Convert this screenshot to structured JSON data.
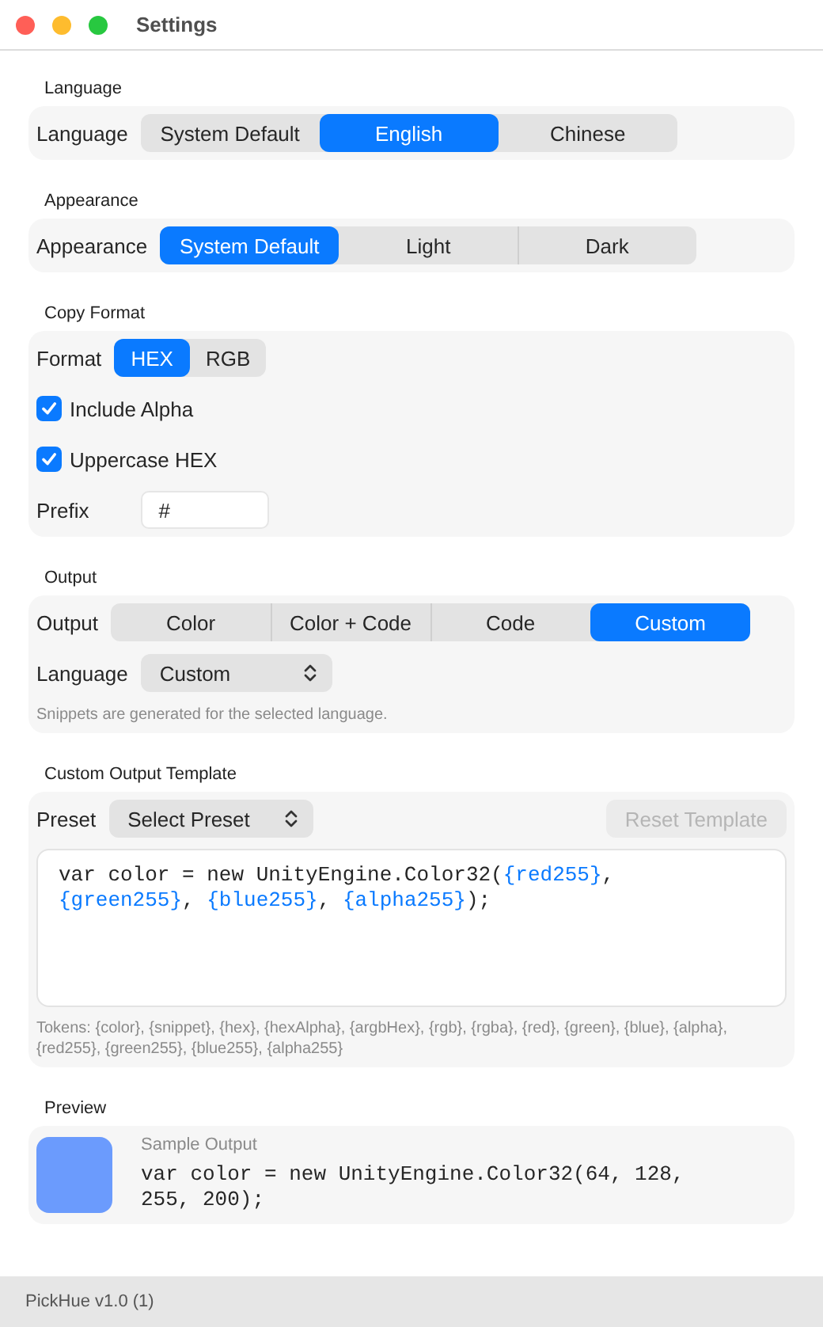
{
  "window": {
    "title": "Settings"
  },
  "language": {
    "heading": "Language",
    "label": "Language",
    "options": [
      {
        "label": "System Default",
        "selected": false
      },
      {
        "label": "English",
        "selected": true
      },
      {
        "label": "Chinese",
        "selected": false
      }
    ]
  },
  "appearance": {
    "heading": "Appearance",
    "label": "Appearance",
    "options": [
      {
        "label": "System Default",
        "selected": true
      },
      {
        "label": "Light",
        "selected": false
      },
      {
        "label": "Dark",
        "selected": false
      }
    ]
  },
  "copy_format": {
    "heading": "Copy Format",
    "format": {
      "label": "Format",
      "options": [
        {
          "label": "HEX",
          "selected": true
        },
        {
          "label": "RGB",
          "selected": false
        }
      ]
    },
    "checkboxes": [
      {
        "label": "Include Alpha",
        "checked": true
      },
      {
        "label": "Uppercase HEX",
        "checked": true
      }
    ],
    "prefix": {
      "label": "Prefix",
      "value": "#"
    }
  },
  "output": {
    "heading": "Output",
    "label": "Output",
    "options": [
      {
        "label": "Color",
        "selected": false
      },
      {
        "label": "Color + Code",
        "selected": false
      },
      {
        "label": "Code",
        "selected": false
      },
      {
        "label": "Custom",
        "selected": true
      }
    ],
    "language": {
      "label": "Language",
      "value": "Custom"
    },
    "note": "Snippets are generated for the selected language."
  },
  "custom_output_template": {
    "heading": "Custom Output Template",
    "preset": {
      "label": "Preset",
      "value": "Select Preset"
    },
    "reset_button": {
      "label": "Reset Template",
      "disabled": true
    },
    "template": [
      {
        "kind": "text",
        "text": "var color = new UnityEngine.Color32("
      },
      {
        "kind": "token",
        "text": "{red255}"
      },
      {
        "kind": "text",
        "text": ", "
      },
      {
        "kind": "token",
        "text": "{green255}"
      },
      {
        "kind": "text",
        "text": ", "
      },
      {
        "kind": "token",
        "text": "{blue255}"
      },
      {
        "kind": "text",
        "text": ", "
      },
      {
        "kind": "token",
        "text": "{alpha255}"
      },
      {
        "kind": "text",
        "text": ");"
      }
    ],
    "tokens_note": "Tokens: {color}, {snippet}, {hex}, {hexAlpha}, {argbHex}, {rgb}, {rgba}, {red}, {green}, {blue}, {alpha}, {red255}, {green255}, {blue255}, {alpha255}"
  },
  "preview": {
    "heading": "Preview",
    "color": "#6b9bfd",
    "caption": "Sample Output",
    "code": "var color = new UnityEngine.Color32(64, 128, 255, 200);"
  },
  "status_bar": {
    "text": "PickHue v1.0 (1)"
  }
}
